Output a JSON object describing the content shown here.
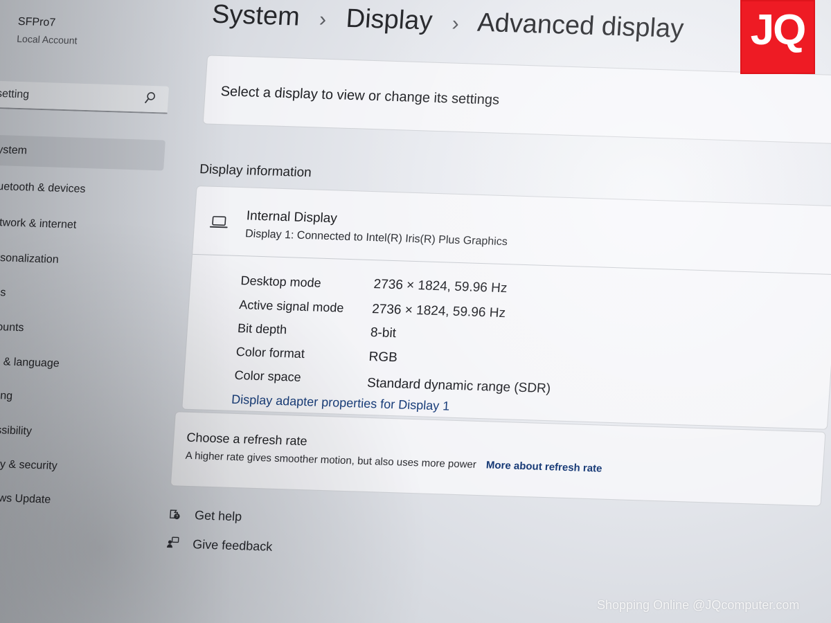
{
  "account": {
    "name": "SFPro7",
    "type": "Local Account"
  },
  "search": {
    "value": "setting"
  },
  "sidebar": {
    "items": [
      {
        "label": "System",
        "active": true
      },
      {
        "label": "Bluetooth & devices"
      },
      {
        "label": "Network & internet"
      },
      {
        "label": "Personalization"
      },
      {
        "label": "Apps"
      },
      {
        "label": "Accounts"
      },
      {
        "label": "Time & language"
      },
      {
        "label": "Gaming"
      },
      {
        "label": "Accessibility"
      },
      {
        "label": "Privacy & security"
      },
      {
        "label": "Windows Update"
      }
    ]
  },
  "breadcrumb": {
    "items": [
      "System",
      "Display",
      "Advanced display"
    ]
  },
  "select_display": {
    "text": "Select a display to view or change its settings"
  },
  "display_info": {
    "section_title": "Display information",
    "display_name": "Internal Display",
    "display_desc": "Display 1: Connected to Intel(R) Iris(R) Plus Graphics",
    "rows": [
      {
        "label": "Desktop mode",
        "value": "2736 × 1824, 59.96 Hz"
      },
      {
        "label": "Active signal mode",
        "value": "2736 × 1824, 59.96 Hz"
      },
      {
        "label": "Bit depth",
        "value": "8-bit"
      },
      {
        "label": "Color format",
        "value": "RGB"
      },
      {
        "label": "Color space",
        "value": "Standard dynamic range (SDR)"
      }
    ],
    "adapter_link": "Display adapter properties for Display 1"
  },
  "refresh_rate": {
    "title": "Choose a refresh rate",
    "description": "A higher rate gives smoother motion, but also uses more power",
    "link": "More about refresh rate"
  },
  "help": {
    "get_help": "Get help",
    "give_feedback": "Give feedback"
  },
  "overlay": {
    "logo": "JQ",
    "watermark": "Shopping Online @JQcomputer.com",
    "logo_color": "#ee1b24"
  },
  "icons": {
    "search": "search-icon",
    "laptop": "laptop-icon",
    "help": "help-icon",
    "feedback": "feedback-icon"
  }
}
